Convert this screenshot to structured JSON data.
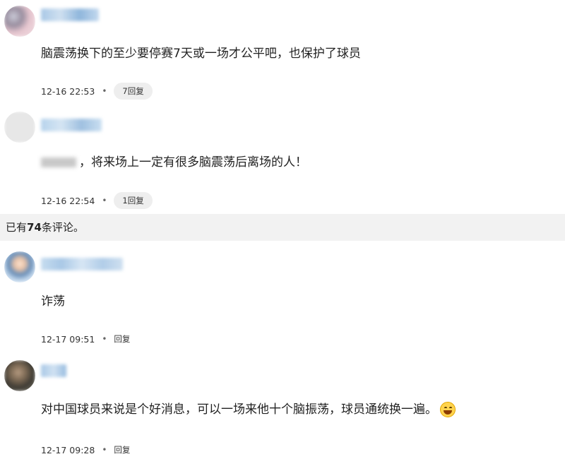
{
  "comments": [
    {
      "content": "脑震荡换下的至少要停赛7天或一场才公平吧，也保护了球员",
      "timestamp": "12-16 22:53",
      "reply_label": "7回复"
    },
    {
      "content": "，将来场上一定有很多脑震荡后离场的人！",
      "timestamp": "12-16 22:54",
      "reply_label": "1回复"
    },
    {
      "content": "诈荡",
      "timestamp": "12-17 09:51",
      "reply_label": "回复"
    },
    {
      "content": "对中国球员来说是个好消息，可以一场来他十个脑振荡，球员通统换一遍。",
      "timestamp": "12-17 09:28",
      "reply_label": "回复"
    }
  ],
  "summary": {
    "prefix": "已有",
    "count": "74",
    "suffix": "条评论。"
  },
  "separator": "•",
  "icons": {
    "emoji": "laughing-emoji-icon",
    "avatar": "user-avatar-icon"
  },
  "colors": {
    "divider_bg": "#f2f2f2",
    "pill_bg": "#eeeeee",
    "text": "#222222"
  }
}
